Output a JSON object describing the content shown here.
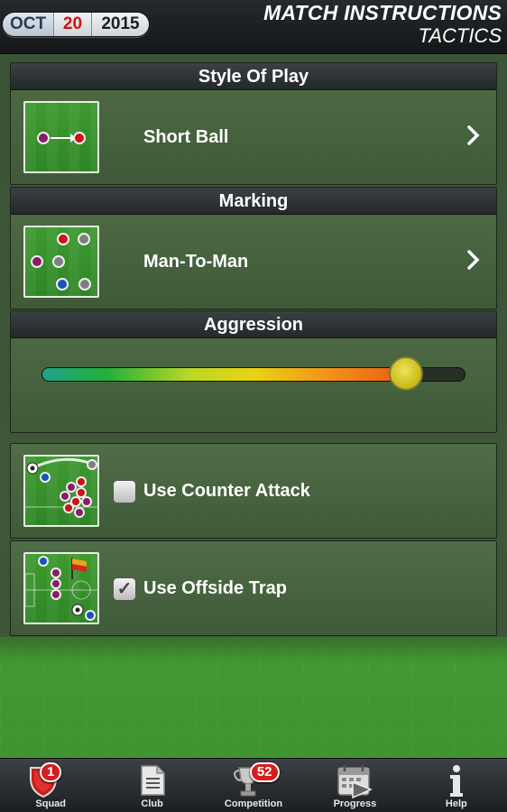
{
  "header": {
    "date": {
      "month": "OCT",
      "day": "20",
      "year": "2015"
    },
    "title": "MATCH INSTRUCTIONS",
    "subtitle": "TACTICS"
  },
  "style_of_play": {
    "heading": "Style Of Play",
    "value": "Short Ball",
    "icon": "short-pass-icon"
  },
  "marking": {
    "heading": "Marking",
    "value": "Man-To-Man",
    "icon": "marking-formation-icon"
  },
  "aggression": {
    "heading": "Aggression",
    "level": 0.86
  },
  "options": [
    {
      "label": "Use Counter Attack",
      "checked": false,
      "icon": "counter-attack-icon"
    },
    {
      "label": "Use Offside Trap",
      "checked": true,
      "icon": "offside-trap-icon"
    }
  ],
  "tabs": [
    {
      "label": "Squad",
      "icon": "shield-icon",
      "badge": "1"
    },
    {
      "label": "Club",
      "icon": "document-icon"
    },
    {
      "label": "Competition",
      "icon": "trophy-icon",
      "badge": "52"
    },
    {
      "label": "Progress",
      "icon": "calendar-icon"
    },
    {
      "label": "Help",
      "icon": "info-icon"
    }
  ],
  "colors": {
    "slider_start": "#1ea38a",
    "slider_end": "#e95d12",
    "knob": "#d9cc2a",
    "badge": "#d51d1d"
  }
}
